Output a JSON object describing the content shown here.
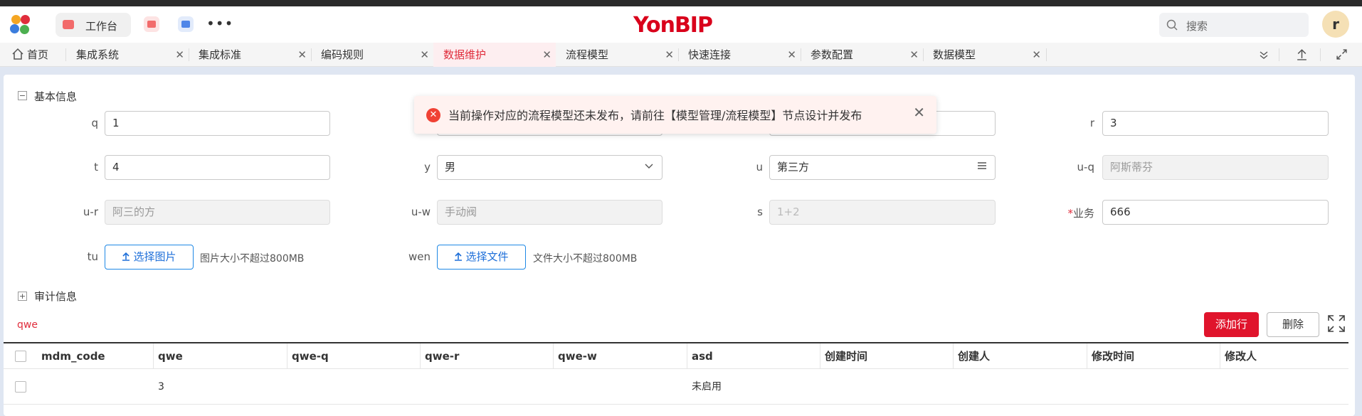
{
  "header": {
    "workbench_label": "工作台",
    "more_label": "•••",
    "brand_yon": "Yon",
    "brand_bip": "BIP",
    "search_placeholder": "搜索",
    "avatar_letter": "r"
  },
  "tabs": [
    {
      "label": "首页",
      "closable": false,
      "active": false
    },
    {
      "label": "集成系统",
      "closable": true,
      "active": false
    },
    {
      "label": "集成标准",
      "closable": true,
      "active": false
    },
    {
      "label": "编码规则",
      "closable": true,
      "active": false
    },
    {
      "label": "数据维护",
      "closable": true,
      "active": true
    },
    {
      "label": "流程模型",
      "closable": true,
      "active": false
    },
    {
      "label": "快速连接",
      "closable": true,
      "active": false
    },
    {
      "label": "参数配置",
      "closable": true,
      "active": false
    },
    {
      "label": "数据模型",
      "closable": true,
      "active": false
    }
  ],
  "tab_close_glyph": "✕",
  "toast": {
    "message": "当前操作对应的流程模型还未发布，请前往【模型管理/流程模型】节点设计并发布",
    "icon": "error-icon",
    "close": "✕"
  },
  "basic_section": {
    "title": "基本信息",
    "toggle": "−"
  },
  "fields": {
    "q": {
      "label": "q",
      "value": "1"
    },
    "r": {
      "label": "r",
      "value": "3"
    },
    "t": {
      "label": "t",
      "value": "4"
    },
    "y": {
      "label": "y",
      "value": "男"
    },
    "u": {
      "label": "u",
      "value": "第三方"
    },
    "u_q": {
      "label": "u-q",
      "value": "阿斯蒂芬"
    },
    "u_r": {
      "label": "u-r",
      "value": "阿三的方"
    },
    "u_w": {
      "label": "u-w",
      "value": "手动阀"
    },
    "s": {
      "label": "s",
      "value": "1+2"
    },
    "yewu": {
      "label": "业务",
      "required_mark": "*",
      "value": "666"
    },
    "tu": {
      "label": "tu",
      "button": "选择图片",
      "hint": "图片大小不超过800MB"
    },
    "wen": {
      "label": "wen",
      "button": "选择文件",
      "hint": "文件大小不超过800MB"
    }
  },
  "audit_section": {
    "title": "审计信息",
    "toggle": "+"
  },
  "table": {
    "title": "qwe",
    "add_button": "添加行",
    "delete_button": "删除",
    "columns": [
      "mdm_code",
      "qwe",
      "qwe-q",
      "qwe-r",
      "qwe-w",
      "asd",
      "创建时间",
      "创建人",
      "修改时间",
      "修改人"
    ],
    "rows": [
      {
        "mdm_code": "",
        "qwe": "3",
        "qwe_q": "",
        "qwe_r": "",
        "qwe_w": "",
        "asd": "未启用",
        "created_at": "",
        "created_by": "",
        "modified_at": "",
        "modified_by": ""
      }
    ]
  },
  "colors": {
    "brand_red": "#d9001b",
    "accent_red": "#e0142c",
    "link_blue": "#1e6fd9"
  }
}
